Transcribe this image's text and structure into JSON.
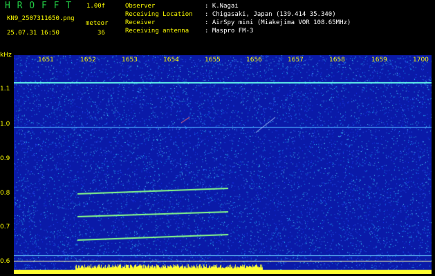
{
  "header": {
    "logo_text": "H R O F F T",
    "version": "1.00f",
    "filename": "KN9_2507311650.png",
    "datetime": "25.07.31 16:50",
    "meteor_label": "meteor",
    "meteor_count": "36",
    "info_labels": [
      "Observer",
      "Receiving Location",
      "Receiver",
      "Receiving antenna"
    ],
    "info_values": [
      ": K.Nagai",
      ": Chigasaki, Japan (139.414 35.340)",
      ": AirSpy mini (Miakejima VOR 108.65MHz)",
      ": Maspro FM-3"
    ]
  },
  "y_axis": {
    "unit": "kHz",
    "ticks": [
      "1.1",
      "1.0",
      "0.9",
      "0.8",
      "0.7",
      "0.6"
    ]
  },
  "x_axis": {
    "ticks": [
      "1651",
      "1652",
      "1653",
      "1654",
      "1655",
      "1656",
      "1657",
      "1658",
      "1659",
      "1700"
    ]
  },
  "colors": {
    "background": "#000000",
    "plot_bg": "#0a1aa8",
    "label": "#ffff00",
    "header_value": "#ffffff",
    "logo": "#22cc44"
  }
}
